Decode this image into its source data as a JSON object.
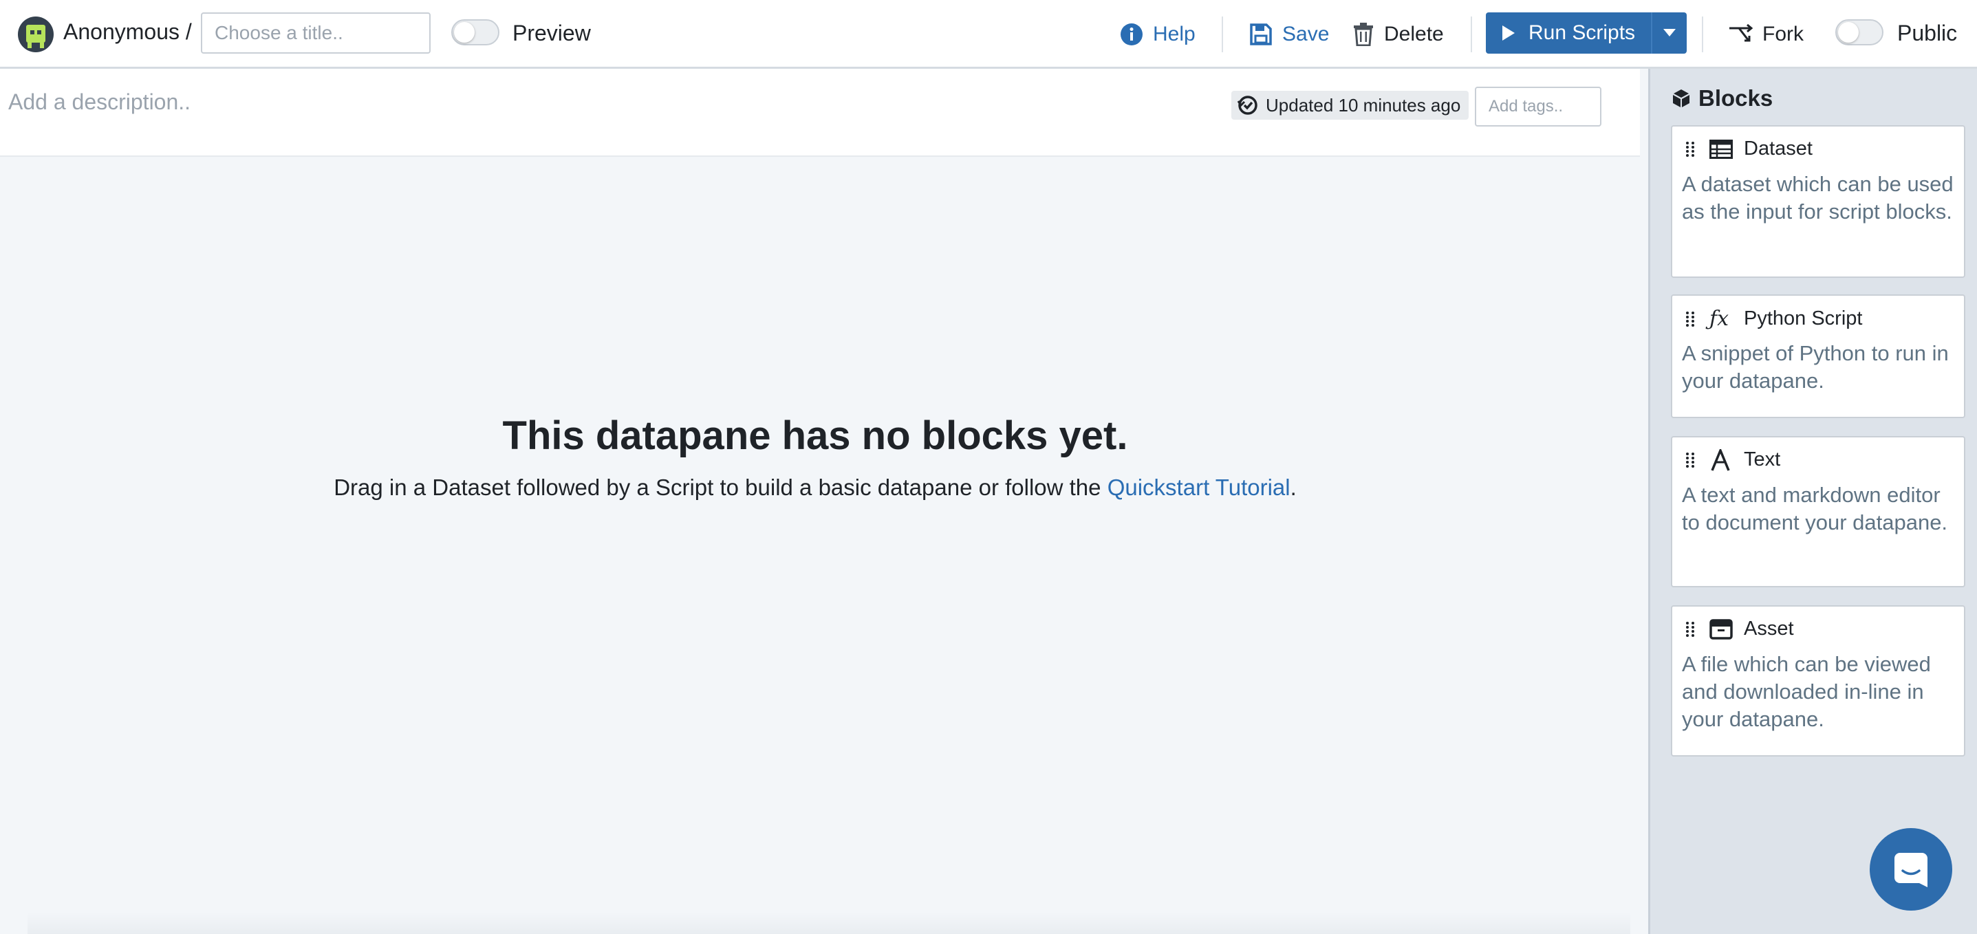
{
  "header": {
    "user": "Anonymous /",
    "title_placeholder": "Choose a title..",
    "preview_label": "Preview",
    "help_label": "Help",
    "save_label": "Save",
    "delete_label": "Delete",
    "run_label": "Run Scripts",
    "fork_label": "Fork",
    "public_label": "Public"
  },
  "description": {
    "placeholder": "Add a description..",
    "updated": "Updated 10 minutes ago",
    "tags_placeholder": "Add tags.."
  },
  "empty_state": {
    "title": "This datapane has no blocks yet.",
    "text": "Drag in a Dataset followed by a Script to build a basic datapane or follow the",
    "link": "Quickstart Tutorial",
    "suffix": "."
  },
  "sidebar": {
    "title": "Blocks",
    "blocks": [
      {
        "name": "Dataset",
        "icon": "table-icon",
        "description": "A dataset which can be used as the input for script blocks."
      },
      {
        "name": "Python Script",
        "icon": "function-icon",
        "description": "A snippet of Python to run in your datapane."
      },
      {
        "name": "Text",
        "icon": "text-icon",
        "description": "A text and markdown editor to document your datapane."
      },
      {
        "name": "Asset",
        "icon": "archive-icon",
        "description": "A file which can be viewed and downloaded in-line in your datapane."
      }
    ]
  },
  "colors": {
    "accent": "#2d6cad",
    "link": "#2a6db3",
    "sidebar_bg": "#dde3ea",
    "canvas_bg": "#f3f6f9"
  }
}
